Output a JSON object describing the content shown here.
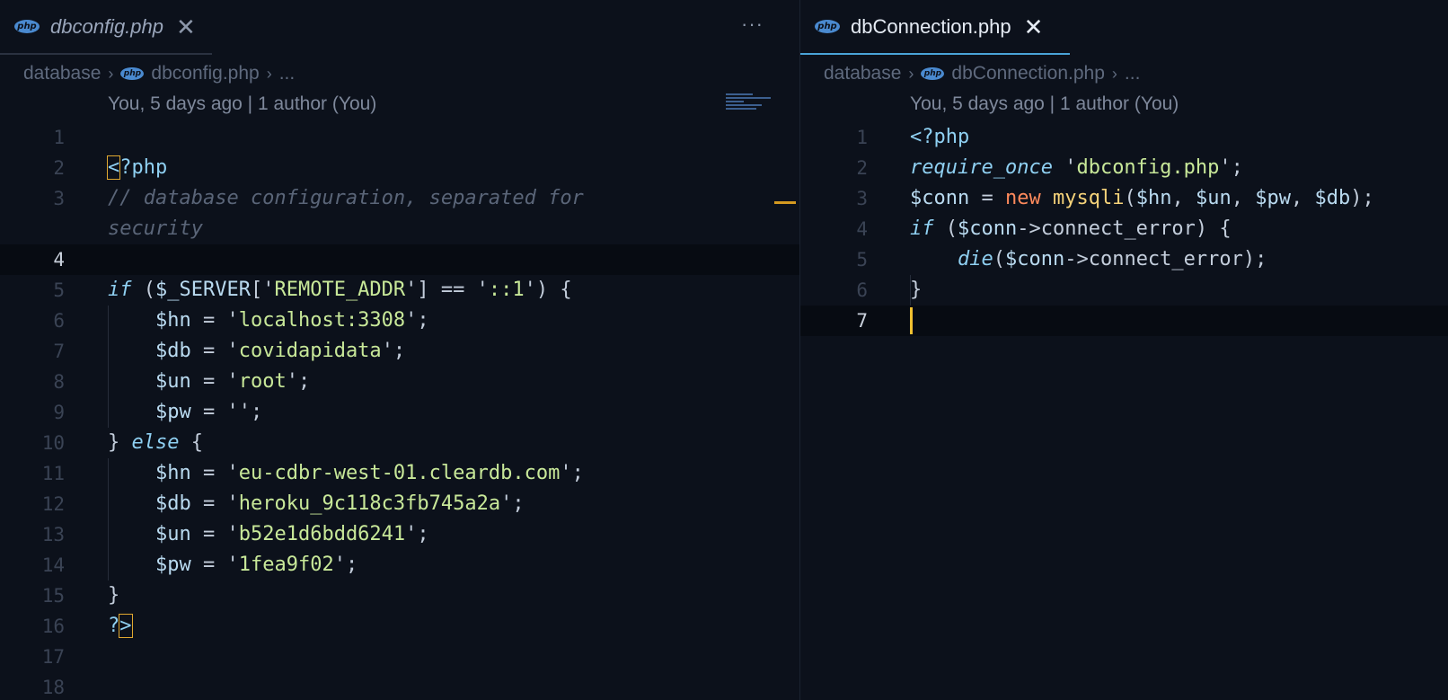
{
  "left": {
    "tab": {
      "icon": "php-icon",
      "icon_text": "php",
      "title": "dbconfig.php"
    },
    "breadcrumb": [
      "database",
      "dbconfig.php",
      "..."
    ],
    "blame": "You, 5 days ago | 1 author (You)",
    "lines": [
      {
        "n": "1",
        "html": ""
      },
      {
        "n": "2",
        "html": "<span class=\"c-tag bracket-hl\">&lt;</span><span class=\"c-tag\">?php</span>"
      },
      {
        "n": "3",
        "html": "<span class=\"c-cmt\">// database configuration, separated for</span>"
      },
      {
        "n": "",
        "html": "<span class=\"c-cmt\">security</span>"
      },
      {
        "n": "4",
        "html": "",
        "current": true
      },
      {
        "n": "5",
        "html": "<span class=\"c-kw\">if</span> <span class=\"c-punc\">(</span><span class=\"c-var\">$_SERVER</span><span class=\"c-punc\">['</span><span class=\"c-str\">REMOTE_ADDR</span><span class=\"c-punc\">'] == '</span><span class=\"c-str\">::1</span><span class=\"c-punc\">') {</span>"
      },
      {
        "n": "6",
        "html": "    <span class=\"c-var\">$hn</span> <span class=\"c-punc\">= '</span><span class=\"c-str\">localhost:3308</span><span class=\"c-punc\">';</span>"
      },
      {
        "n": "7",
        "html": "    <span class=\"c-var\">$db</span> <span class=\"c-punc\">= '</span><span class=\"c-str\">covidapidata</span><span class=\"c-punc\">';</span>"
      },
      {
        "n": "8",
        "html": "    <span class=\"c-var\">$un</span> <span class=\"c-punc\">= '</span><span class=\"c-str\">root</span><span class=\"c-punc\">';</span>"
      },
      {
        "n": "9",
        "html": "    <span class=\"c-var\">$pw</span> <span class=\"c-punc\">= '';</span>"
      },
      {
        "n": "10",
        "html": "<span class=\"c-punc\">} </span><span class=\"c-kw\">else</span><span class=\"c-punc\"> {</span>"
      },
      {
        "n": "11",
        "html": "    <span class=\"c-var\">$hn</span> <span class=\"c-punc\">= '</span><span class=\"c-str\">eu-cdbr-west-01.cleardb.com</span><span class=\"c-punc\">';</span>"
      },
      {
        "n": "12",
        "html": "    <span class=\"c-var\">$db</span> <span class=\"c-punc\">= '</span><span class=\"c-str\">heroku_9c118c3fb745a2a</span><span class=\"c-punc\">';</span>"
      },
      {
        "n": "13",
        "html": "    <span class=\"c-var\">$un</span> <span class=\"c-punc\">= '</span><span class=\"c-str\">b52e1d6bdd6241</span><span class=\"c-punc\">';</span>"
      },
      {
        "n": "14",
        "html": "    <span class=\"c-var\">$pw</span> <span class=\"c-punc\">= '</span><span class=\"c-str\">1fea9f02</span><span class=\"c-punc\">';</span>"
      },
      {
        "n": "15",
        "html": "<span class=\"c-punc\">}</span>"
      },
      {
        "n": "16",
        "html": "<span class=\"c-tag\">?</span><span class=\"c-tag bracket-hl\">&gt;</span>"
      },
      {
        "n": "17",
        "html": ""
      },
      {
        "n": "18",
        "html": ""
      }
    ]
  },
  "right": {
    "tab": {
      "icon": "php-icon",
      "icon_text": "php",
      "title": "dbConnection.php"
    },
    "breadcrumb": [
      "database",
      "dbConnection.php",
      "..."
    ],
    "blame": "You, 5 days ago | 1 author (You)",
    "lines": [
      {
        "n": "1",
        "html": "<span class=\"c-tag\">&lt;?php</span>"
      },
      {
        "n": "2",
        "html": "<span class=\"c-kw\">require_once</span> <span class=\"c-punc\">'</span><span class=\"c-str\">dbconfig.php</span><span class=\"c-punc\">';</span>"
      },
      {
        "n": "3",
        "html": "<span class=\"c-var\">$conn</span> <span class=\"c-punc\">= </span><span class=\"c-new\">new</span> <span class=\"c-cls\">mysqli</span><span class=\"c-punc\">(</span><span class=\"c-var\">$hn</span><span class=\"c-punc\">, </span><span class=\"c-var\">$un</span><span class=\"c-punc\">, </span><span class=\"c-var\">$pw</span><span class=\"c-punc\">, </span><span class=\"c-var\">$db</span><span class=\"c-punc\">);</span>"
      },
      {
        "n": "4",
        "html": "<span class=\"c-kw\">if</span> <span class=\"c-punc\">(</span><span class=\"c-var\">$conn</span><span class=\"c-punc\">-&gt;connect_error) {</span>"
      },
      {
        "n": "5",
        "html": "    <span class=\"c-fn\">die</span><span class=\"c-punc\">(</span><span class=\"c-var\">$conn</span><span class=\"c-punc\">-&gt;connect_error);</span>"
      },
      {
        "n": "6",
        "html": "<span class=\"c-punc\">}</span>"
      },
      {
        "n": "7",
        "html": "<span class=\"cursor\"></span>",
        "current": true
      }
    ]
  },
  "editor": {
    "more_actions_label": "···",
    "close_glyph": "✕",
    "sep_glyph": "›"
  }
}
